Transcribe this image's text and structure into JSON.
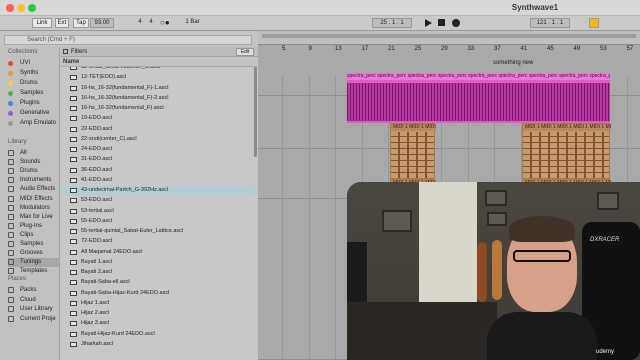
{
  "window": {
    "title": "Synthwave1"
  },
  "transport": {
    "link": "Link",
    "ext": "Ext",
    "tap": "Tap",
    "tempo": "93.00",
    "sig_num": "4",
    "sig_den": "4",
    "metro": "1 Bar",
    "position": "25 . 1 . 1",
    "loop_start": "121 . 1 . 1"
  },
  "browser": {
    "search_placeholder": "Search (Cmd + F)",
    "collections_title": "Collections",
    "collections": [
      {
        "label": "UVI",
        "color": "#e8453c"
      },
      {
        "label": "Synths",
        "color": "#f29a2e"
      },
      {
        "label": "Drums",
        "color": "#f5d23a"
      },
      {
        "label": "Samples",
        "color": "#46b04e"
      },
      {
        "label": "Plugins",
        "color": "#3c8ee8"
      },
      {
        "label": "Generative",
        "color": "#9a59d8"
      },
      {
        "label": "Amp Emulato",
        "color": "#9a9a9a"
      }
    ],
    "library_title": "Library",
    "library": [
      "All",
      "Sounds",
      "Drums",
      "Instruments",
      "Audio Effects",
      "MIDI Effects",
      "Modulators",
      "Max for Live",
      "Plug-Ins",
      "Clips",
      "Samples",
      "Grooves",
      "Tunings",
      "Templates"
    ],
    "library_selected": "Tunings",
    "places_title": "Places",
    "places": [
      "Packs",
      "Cloud",
      "User Library",
      "Current Proje"
    ],
    "filters_label": "Filters",
    "edit_label": "Edit",
    "name_header": "Name",
    "files": [
      "12-tertial_Gmat-eccenter_C.ascl",
      "12-TET(EDO).ascl",
      "16-hs_16-32(fundamental_F)-1.ascl",
      "16-hs_16-32(fundamental_F)-2.ascl",
      "16-hs_16-32(fundamental_F).ascl",
      "19-EDO.ascl",
      "22-EDO.ascl",
      "22-sruti(center_C).ascl",
      "24-EDO.ascl",
      "31-EDO.ascl",
      "36-EDO.ascl",
      "41-EDO.ascl",
      "43-undecimal-Partch_G-392Hz.ascl",
      "53-EDO.ascl",
      "53-tertial.ascl",
      "55-EDO.ascl",
      "55-tertial-quintal_Sabat-Euler_Lattice.ascl",
      "72-EDO.ascl",
      "All Maqamat 24EDO.ascl",
      "Bayati 1.ascl",
      "Bayati 2.ascl",
      "Bayati-Saba-ell.ascl",
      "Bayati-Saba-Hijaz-Kurd 24EDO.ascl",
      "Hijaz 1.ascl",
      "Hijaz 2.ascl",
      "Hijaz 3.ascl",
      "Bayati-Hijaz-Kurd 24EDO.ascl",
      "Jiharkah.ascl"
    ],
    "selected_file_index": 12
  },
  "arrangement": {
    "bar_numbers": [
      "5",
      "9",
      "13",
      "17",
      "21",
      "25",
      "29",
      "33",
      "37",
      "41",
      "45",
      "49",
      "53",
      "57",
      "61"
    ],
    "locator_label": "something new",
    "audio_clip_label": "spectra_perc",
    "midi_clip_label": "MIDI 1"
  },
  "overlay": {
    "watermark": "udemy",
    "chair_brand": "DXRACER"
  }
}
